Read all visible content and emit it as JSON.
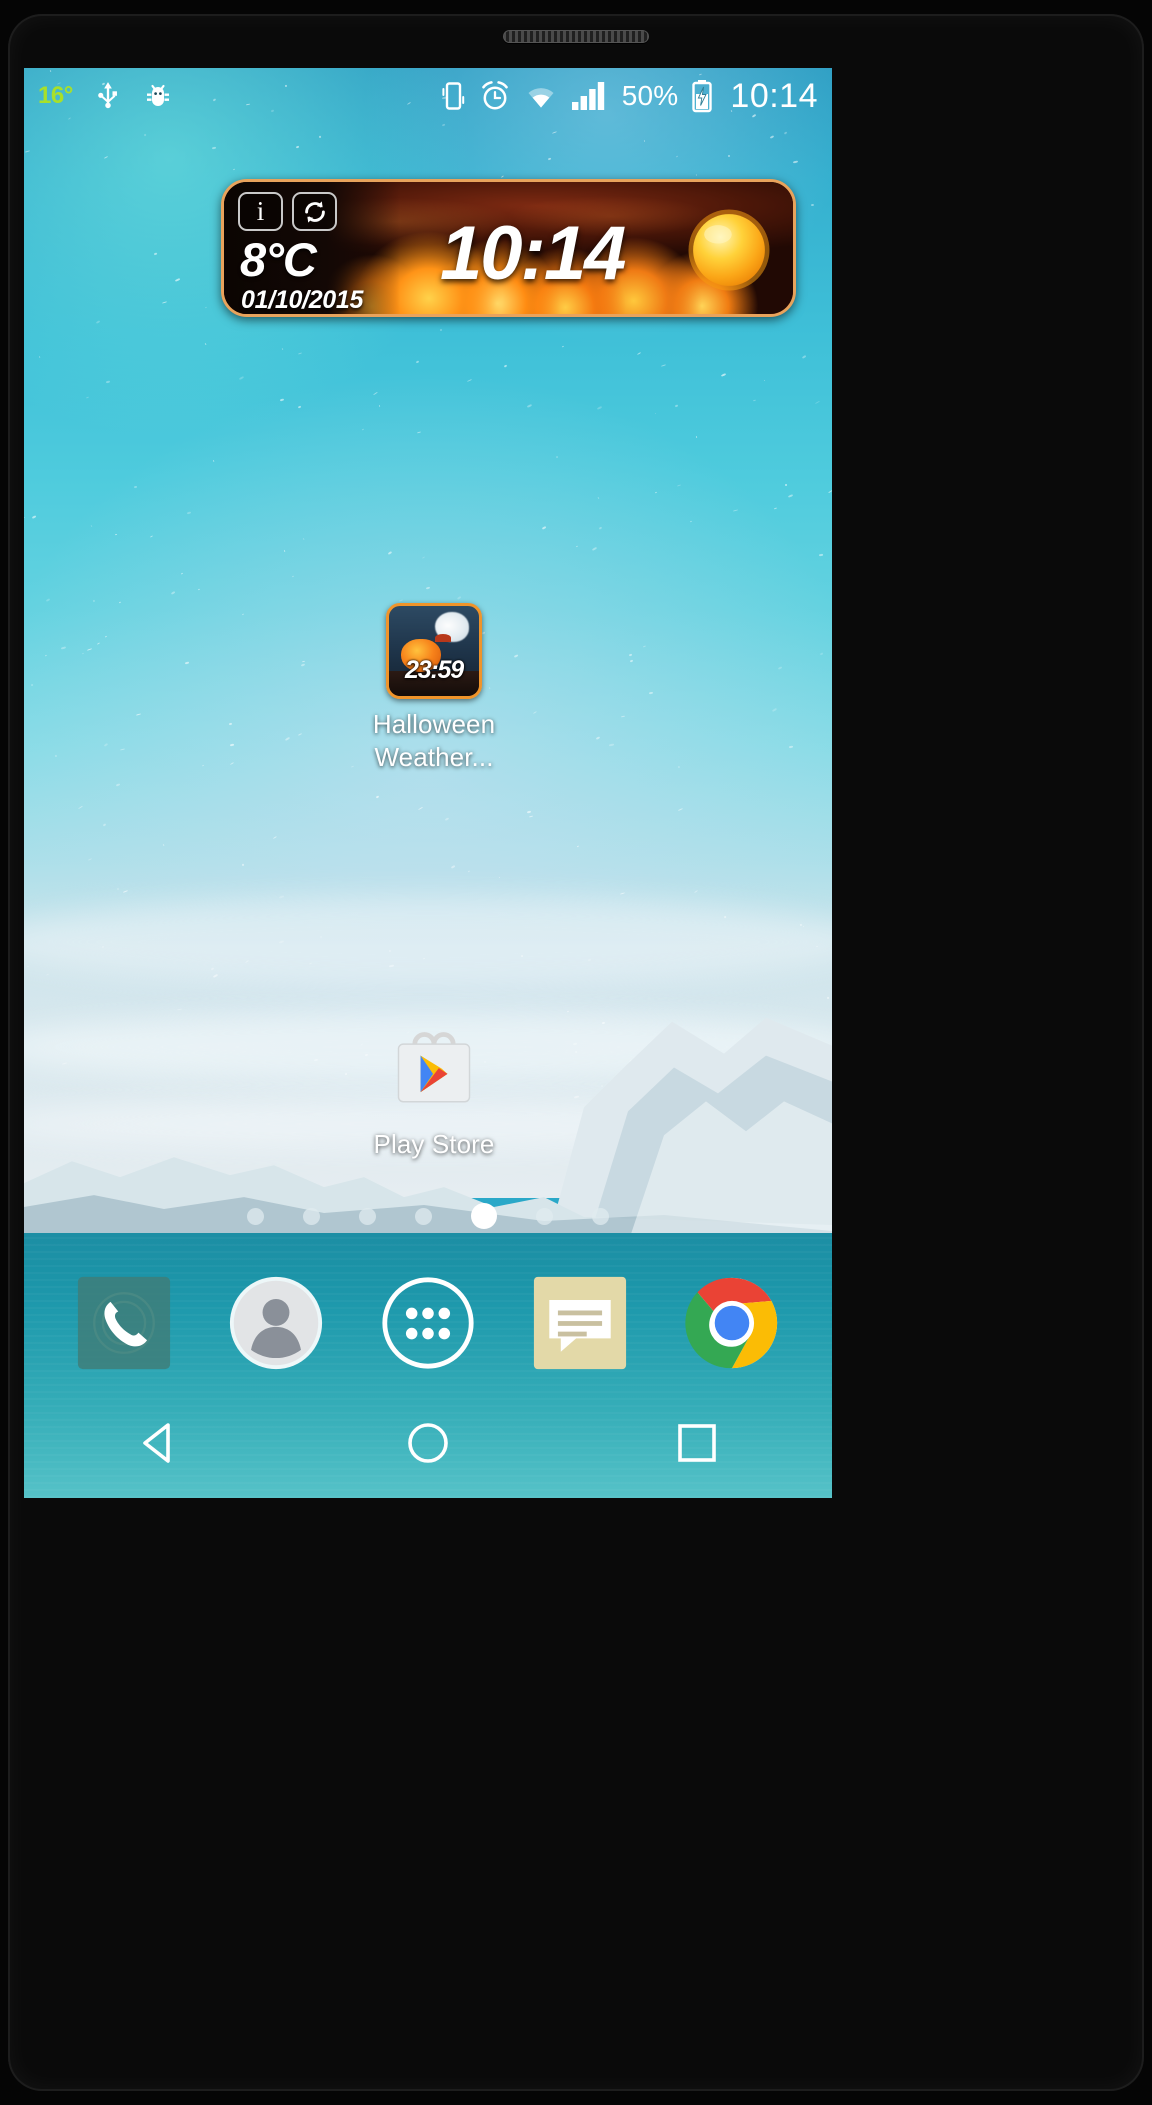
{
  "status_bar": {
    "temperature": "16°",
    "icons_left": [
      "usb-icon",
      "debug-bug-icon"
    ],
    "icons_right": [
      "vibrate-icon",
      "alarm-icon",
      "wifi-icon",
      "signal-icon"
    ],
    "battery_percent": "50%",
    "battery_icon": "battery-charging-icon",
    "clock": "10:14"
  },
  "weather_widget": {
    "info_button": "i",
    "refresh_button": "refresh-icon",
    "temperature": "8°C",
    "date": "01/10/2015",
    "time": "10:14",
    "condition_icon": "sun-icon",
    "border_color": "#e8a35c"
  },
  "apps": [
    {
      "name": "halloween-weather",
      "label": "Halloween\nWeather...",
      "icon_time": "23:59",
      "icon_border_color": "#f0942a"
    },
    {
      "name": "play-store",
      "label": "Play Store",
      "icon": "play-store-icon"
    }
  ],
  "page_indicator": {
    "total": 7,
    "active_index": 4
  },
  "dock": [
    {
      "name": "phone",
      "icon": "phone-icon",
      "color": "#3f7d77"
    },
    {
      "name": "contacts",
      "icon": "person-icon",
      "color": "#ffffff"
    },
    {
      "name": "app-drawer",
      "icon": "apps-grid-icon",
      "color": "#ffffff"
    },
    {
      "name": "messaging",
      "icon": "message-icon",
      "color": "#e3d9a8"
    },
    {
      "name": "chrome",
      "icon": "chrome-icon",
      "color": "#4285f4"
    }
  ],
  "nav_bar": [
    {
      "name": "back",
      "icon": "back-triangle-icon"
    },
    {
      "name": "home",
      "icon": "home-circle-icon"
    },
    {
      "name": "recents",
      "icon": "recents-square-icon"
    }
  ]
}
